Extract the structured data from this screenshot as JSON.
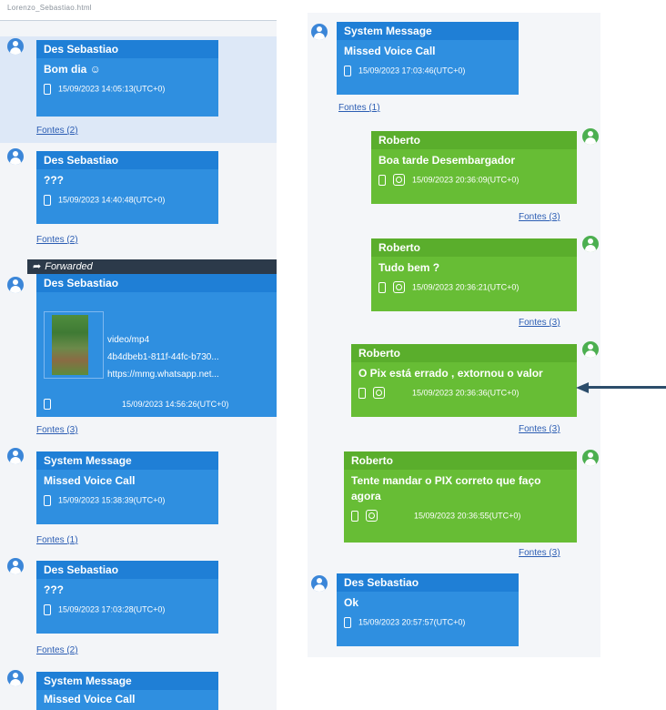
{
  "topbar": {
    "text": "Lorenzo_Sebastiao.html"
  },
  "forwarded_label": "Forwarded",
  "left_messages": [
    {
      "sender": "Des Sebastiao",
      "text": "Bom dia ☺",
      "timestamp": "15/09/2023 14:05:13(UTC+0)",
      "fontes": "Fontes (2)"
    },
    {
      "sender": "Des Sebastiao",
      "text": "???",
      "timestamp": "15/09/2023 14:40:48(UTC+0)",
      "fontes": "Fontes (2)"
    },
    {
      "sender": "Des Sebastiao",
      "media_type": "video/mp4",
      "media_id": "4b4dbeb1-811f-44fc-b730...",
      "media_url": "https://mmg.whatsapp.net...",
      "timestamp": "15/09/2023 14:56:26(UTC+0)",
      "fontes": "Fontes (3)"
    },
    {
      "sender": "System Message",
      "text": "Missed Voice Call",
      "timestamp": "15/09/2023 15:38:39(UTC+0)",
      "fontes": "Fontes (1)"
    },
    {
      "sender": "Des Sebastiao",
      "text": "???",
      "timestamp": "15/09/2023 17:03:28(UTC+0)",
      "fontes": "Fontes (2)"
    },
    {
      "sender": "System Message",
      "text": "Missed Voice Call"
    }
  ],
  "right_messages": [
    {
      "sender": "System Message",
      "text": "Missed Voice Call",
      "timestamp": "15/09/2023 17:03:46(UTC+0)",
      "fontes": "Fontes (1)"
    },
    {
      "sender": "Roberto",
      "text": "Boa tarde Desembargador",
      "timestamp": "15/09/2023 20:36:09(UTC+0)",
      "fontes": "Fontes (3)"
    },
    {
      "sender": "Roberto",
      "text": "Tudo bem ?",
      "timestamp": "15/09/2023 20:36:21(UTC+0)",
      "fontes": "Fontes (3)"
    },
    {
      "sender": "Roberto",
      "text": "O Pix está errado , extornou o valor",
      "timestamp": "15/09/2023 20:36:36(UTC+0)",
      "fontes": "Fontes (3)"
    },
    {
      "sender": "Roberto",
      "text": "Tente mandar o PIX correto que faço agora",
      "timestamp": "15/09/2023 20:36:55(UTC+0)",
      "fontes": "Fontes (3)"
    },
    {
      "sender": "Des Sebastiao",
      "text": "Ok",
      "timestamp": "15/09/2023 20:57:57(UTC+0)"
    }
  ],
  "icons": {
    "avatar": "user-avatar-icon",
    "phone": "phone-icon",
    "sticker": "sticker-icon",
    "forward": "forward-arrow-icon",
    "annotation": "left-arrow-icon"
  },
  "colors": {
    "incoming": "#2f8fe0",
    "outgoing": "#67bd35",
    "link": "#2b5db3",
    "forward_bar": "#2c3a4a"
  }
}
